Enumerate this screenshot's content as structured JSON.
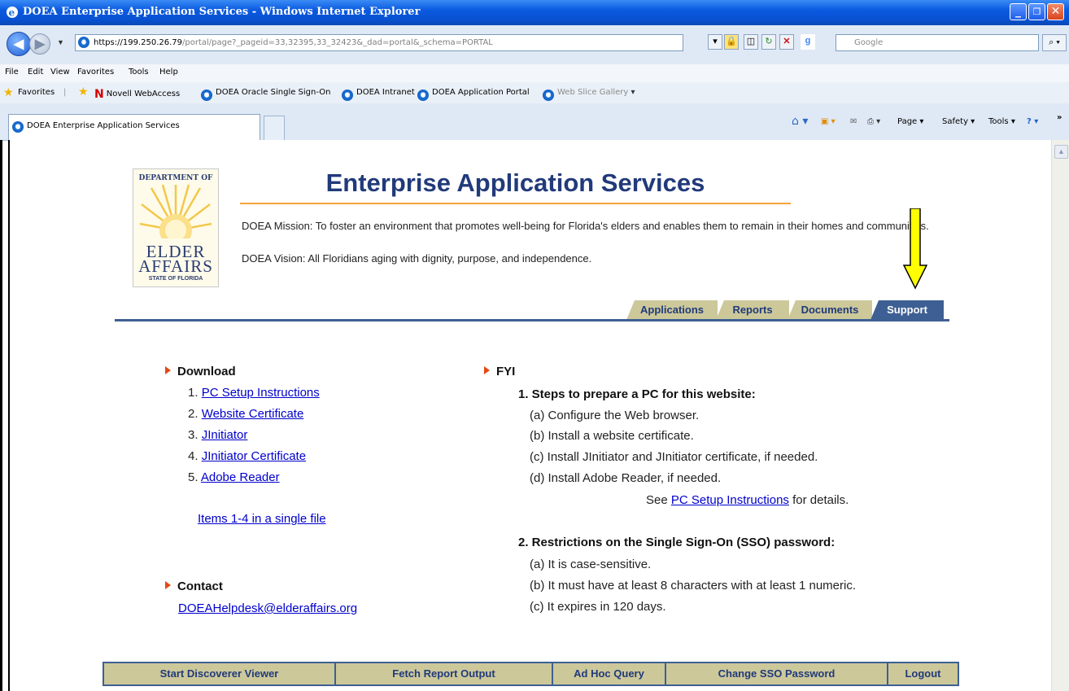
{
  "window": {
    "title": "DOEA Enterprise Application Services - Windows Internet Explorer"
  },
  "address": {
    "url_host": "https://199.250.26.79",
    "url_path": "/portal/page?_pageid=33,32395,33_32423&_dad=portal&_schema=PORTAL",
    "search_placeholder": "Google"
  },
  "menu": [
    "File",
    "Edit",
    "View",
    "Favorites",
    "Tools",
    "Help"
  ],
  "favorites": {
    "label": "Favorites",
    "items": [
      "Novell WebAccess",
      "DOEA Oracle Single Sign-On",
      "DOEA Intranet",
      "DOEA Application Portal",
      "Web Slice Gallery"
    ]
  },
  "tab": {
    "label": "DOEA Enterprise Application Services"
  },
  "commandbar": [
    "Page",
    "Safety",
    "Tools"
  ],
  "logo": {
    "dept": "DEPARTMENT OF",
    "elder": "ELDER",
    "affairs": "AFFAIRS",
    "state": "STATE OF FLORIDA"
  },
  "page": {
    "heading": "Enterprise Application Services",
    "mission": "DOEA Mission: To foster an environment that promotes well-being for Florida's elders and enables them to remain in their homes and communities.",
    "vision": "DOEA Vision: All Floridians aging with dignity, purpose, and independence."
  },
  "tabs": [
    "Applications",
    "Reports",
    "Documents",
    "Support"
  ],
  "download": {
    "title": "Download",
    "items": [
      {
        "num": "1.",
        "label": "PC Setup Instructions"
      },
      {
        "num": "2.",
        "label": "Website Certificate"
      },
      {
        "num": "3.",
        "label": "JInitiator"
      },
      {
        "num": "4.",
        "label": "JInitiator Certificate"
      },
      {
        "num": "5.",
        "label": "Adobe Reader"
      }
    ],
    "single_file": "Items 1-4 in a single file"
  },
  "contact": {
    "title": "Contact",
    "email": "DOEAHelpdesk@elderaffairs.org"
  },
  "fyi": {
    "title": "FYI",
    "s1_title": "1. Steps to prepare a PC for this website:",
    "s1_items": [
      "(a) Configure the Web browser.",
      "(b) Install a website certificate.",
      "(c) Install JInitiator and JInitiator certificate, if needed.",
      "(d) Install Adobe Reader, if needed."
    ],
    "see_pre": "See ",
    "see_link": "PC Setup Instructions",
    "see_post": " for details.",
    "s2_title": "2. Restrictions on the Single Sign-On (SSO) password:",
    "s2_items": [
      "(a) It is case-sensitive.",
      "(b) It must have at least 8 characters with at least 1 numeric.",
      "(c) It expires in 120 days."
    ]
  },
  "footer": [
    "Start Discoverer Viewer",
    "Fetch Report Output",
    "Ad Hoc Query",
    "Change SSO Password",
    "Logout"
  ],
  "colors": {
    "accent": "#213a7a",
    "tab_bg": "#ccc89a",
    "tab_active": "#3e5f93",
    "bullet": "#e24a14",
    "arrow": "#ffff00"
  }
}
